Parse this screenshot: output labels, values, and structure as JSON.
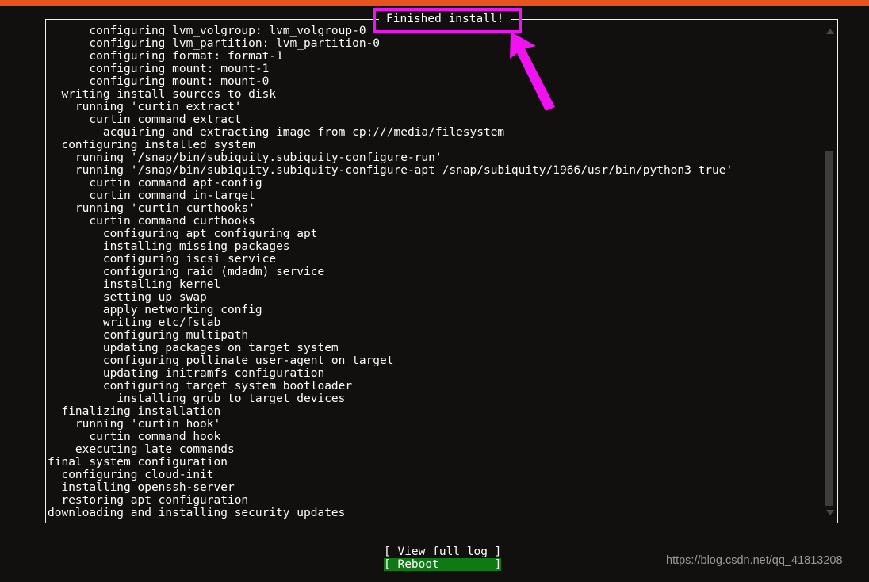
{
  "window": {
    "accent_bar_color": "#e8521f",
    "background_color": "#120f0f",
    "frame_border_color": "#f2f2f2",
    "title": "Finished install!"
  },
  "log": {
    "lines": [
      "      configuring lvm_volgroup: lvm_volgroup-0",
      "      configuring lvm_partition: lvm_partition-0",
      "      configuring format: format-1",
      "      configuring mount: mount-1",
      "      configuring mount: mount-0",
      "  writing install sources to disk",
      "    running 'curtin extract'",
      "      curtin command extract",
      "        acquiring and extracting image from cp:///media/filesystem",
      "  configuring installed system",
      "    running '/snap/bin/subiquity.subiquity-configure-run'",
      "    running '/snap/bin/subiquity.subiquity-configure-apt /snap/subiquity/1966/usr/bin/python3 true'",
      "      curtin command apt-config",
      "      curtin command in-target",
      "    running 'curtin curthooks'",
      "      curtin command curthooks",
      "        configuring apt configuring apt",
      "        installing missing packages",
      "        configuring iscsi service",
      "        configuring raid (mdadm) service",
      "        installing kernel",
      "        setting up swap",
      "        apply networking config",
      "        writing etc/fstab",
      "        configuring multipath",
      "        updating packages on target system",
      "        configuring pollinate user-agent on target",
      "        updating initramfs configuration",
      "        configuring target system bootloader",
      "          installing grub to target devices",
      "  finalizing installation",
      "    running 'curtin hook'",
      "      curtin command hook",
      "    executing late commands",
      "final system configuration",
      "  configuring cloud-init",
      "  installing openssh-server",
      "  restoring apt configuration",
      "downloading and installing security updates"
    ]
  },
  "scrollbar": {
    "up_arrow": "triangle-up-icon",
    "down_arrow": "triangle-down-icon",
    "thumb_color": "#3d3d3d"
  },
  "footer": {
    "view_full_log": "[ View full log ]",
    "reboot": "[ Reboot        ]",
    "reboot_highlight_color": "#0e7a16",
    "selected": "reboot"
  },
  "annotation": {
    "color": "#f012f0",
    "box_target": "Finished install!",
    "arrow": "arrow-pointing-up-left"
  },
  "watermark": {
    "text": "https://blog.csdn.net/qq_41813208"
  }
}
